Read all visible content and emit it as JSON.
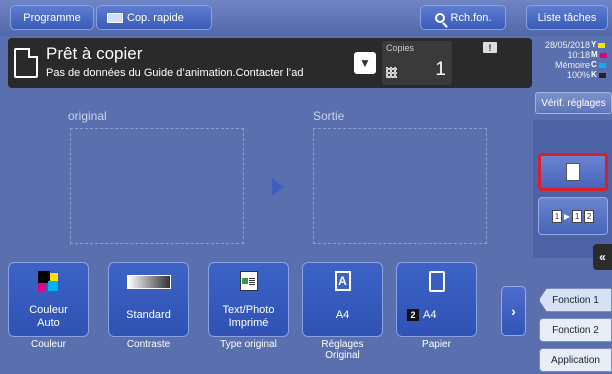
{
  "topbar": {
    "programme_label": "Programme",
    "cop_rapide_label": "Cop. rapide",
    "rch_fon_label": "Rch.fon.",
    "liste_taches_label": "Liste tâches"
  },
  "status": {
    "title": "Prêt à copier",
    "message": "Pas de données du Guide d’animation.Contacter l’ad",
    "copies_label": "Copies",
    "copies_value": "1",
    "date": "28/05/2018",
    "time": "10:18",
    "memory_label": "Mémoire",
    "memory_value": "100%",
    "toner": [
      {
        "letter": "Y",
        "color": "#ffe100"
      },
      {
        "letter": "M",
        "color": "#e4007f"
      },
      {
        "letter": "C",
        "color": "#00b4f0"
      },
      {
        "letter": "K",
        "color": "#222222"
      }
    ]
  },
  "verif_label": "Vérif. réglages",
  "preview": {
    "original_label": "original",
    "sortie_label": "Sortie"
  },
  "functions": [
    {
      "value": "Couleur\nAuto",
      "caption": "Couleur",
      "icon": "color-icon"
    },
    {
      "value": "Standard",
      "caption": "Contraste",
      "icon": "contrast-icon"
    },
    {
      "value": "Text/Photo\nImprimé",
      "caption": "Type original",
      "icon": "text-photo-icon"
    },
    {
      "value": "A4",
      "caption": "Réglages\nOriginal",
      "icon": "original-size-icon"
    },
    {
      "value": "A4",
      "tray": "2",
      "caption": "Papier",
      "icon": "paper-icon"
    }
  ],
  "tabs": {
    "fonction1": "Fonction 1",
    "fonction2": "Fonction 2",
    "application": "Application"
  },
  "colors": {
    "accent": "#3d63c7",
    "background": "#5a6fae",
    "highlight": "#d9202a"
  }
}
